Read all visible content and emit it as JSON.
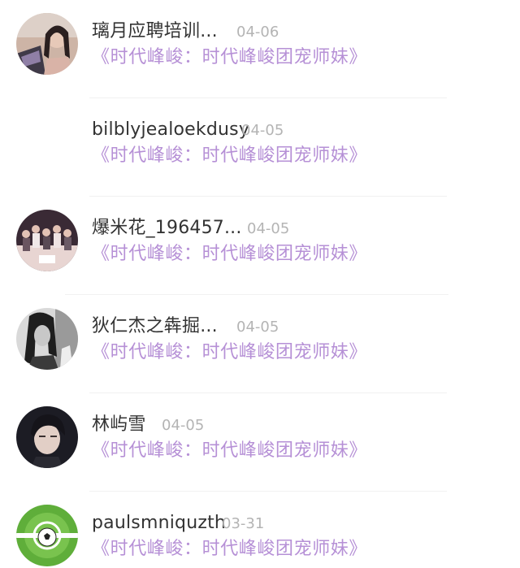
{
  "comments": [
    {
      "username": "璃月应聘培训...",
      "date": "04-06",
      "work_link": "《时代峰峻：时代峰峻团宠师妹》",
      "avatar": "portrait-photo"
    },
    {
      "username": "bilblyjealoekdusy",
      "date": "04-05",
      "work_link": "《时代峰峻：时代峰峻团宠师妹》",
      "avatar": "none"
    },
    {
      "username": "爆米花_196457...",
      "date": "04-05",
      "work_link": "《时代峰峻：时代峰峻团宠师妹》",
      "avatar": "group-photo"
    },
    {
      "username": "狄仁杰之犇掘...",
      "date": "04-05",
      "work_link": "《时代峰峻：时代峰峻团宠师妹》",
      "avatar": "bw-portrait"
    },
    {
      "username": "林屿雪",
      "date": "04-05",
      "work_link": "《时代峰峻：时代峰峻团宠师妹》",
      "avatar": "portrait-photo"
    },
    {
      "username": "paulsmniquzth",
      "date": "03-31",
      "work_link": "《时代峰峻：时代峰峻团宠师妹》",
      "avatar": "soccer-ball"
    }
  ],
  "colors": {
    "username": "#333333",
    "date": "#b4b4b4",
    "link": "#b690d6",
    "background": "#ffffff"
  }
}
